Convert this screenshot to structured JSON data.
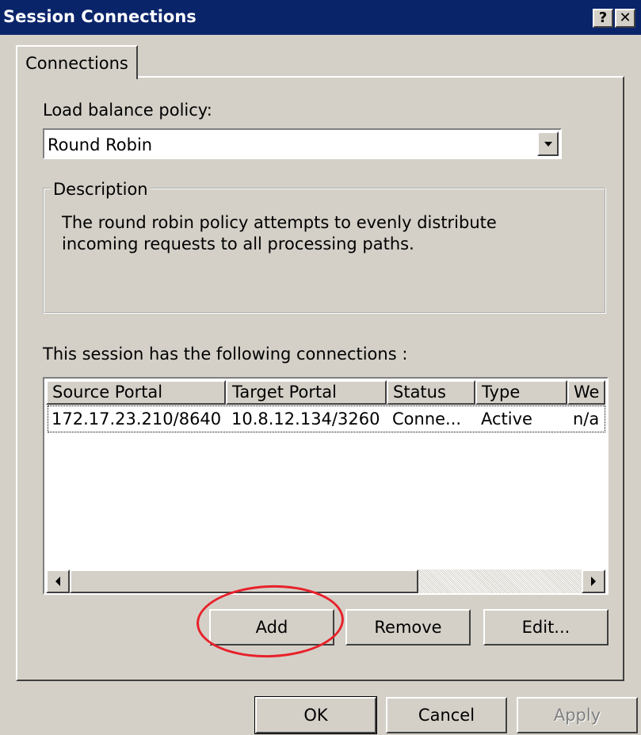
{
  "window": {
    "title": "Session Connections",
    "help_label": "?",
    "close_label": "✕"
  },
  "tabs": [
    {
      "label": "Connections",
      "active": true
    }
  ],
  "load_balance": {
    "label": "Load balance policy:",
    "value": "Round Robin"
  },
  "description": {
    "legend": "Description",
    "text": "The round robin policy attempts to evenly distribute incoming requests to all processing paths."
  },
  "connections": {
    "label": "This session has the following connections :",
    "columns": [
      "Source Portal",
      "Target Portal",
      "Status",
      "Type",
      "We"
    ],
    "rows": [
      [
        "172.17.23.210/8640",
        "10.8.12.134/3260",
        "Conne...",
        "Active",
        "n/a"
      ]
    ]
  },
  "actions": {
    "add": "Add",
    "remove": "Remove",
    "edit": "Edit..."
  },
  "footer": {
    "ok": "OK",
    "cancel": "Cancel",
    "apply": "Apply"
  },
  "annotation": {
    "highlight_color": "#e8212a",
    "target": "add"
  },
  "colors": {
    "title_bar": "#0a246a",
    "face": "#d4d0c8"
  }
}
